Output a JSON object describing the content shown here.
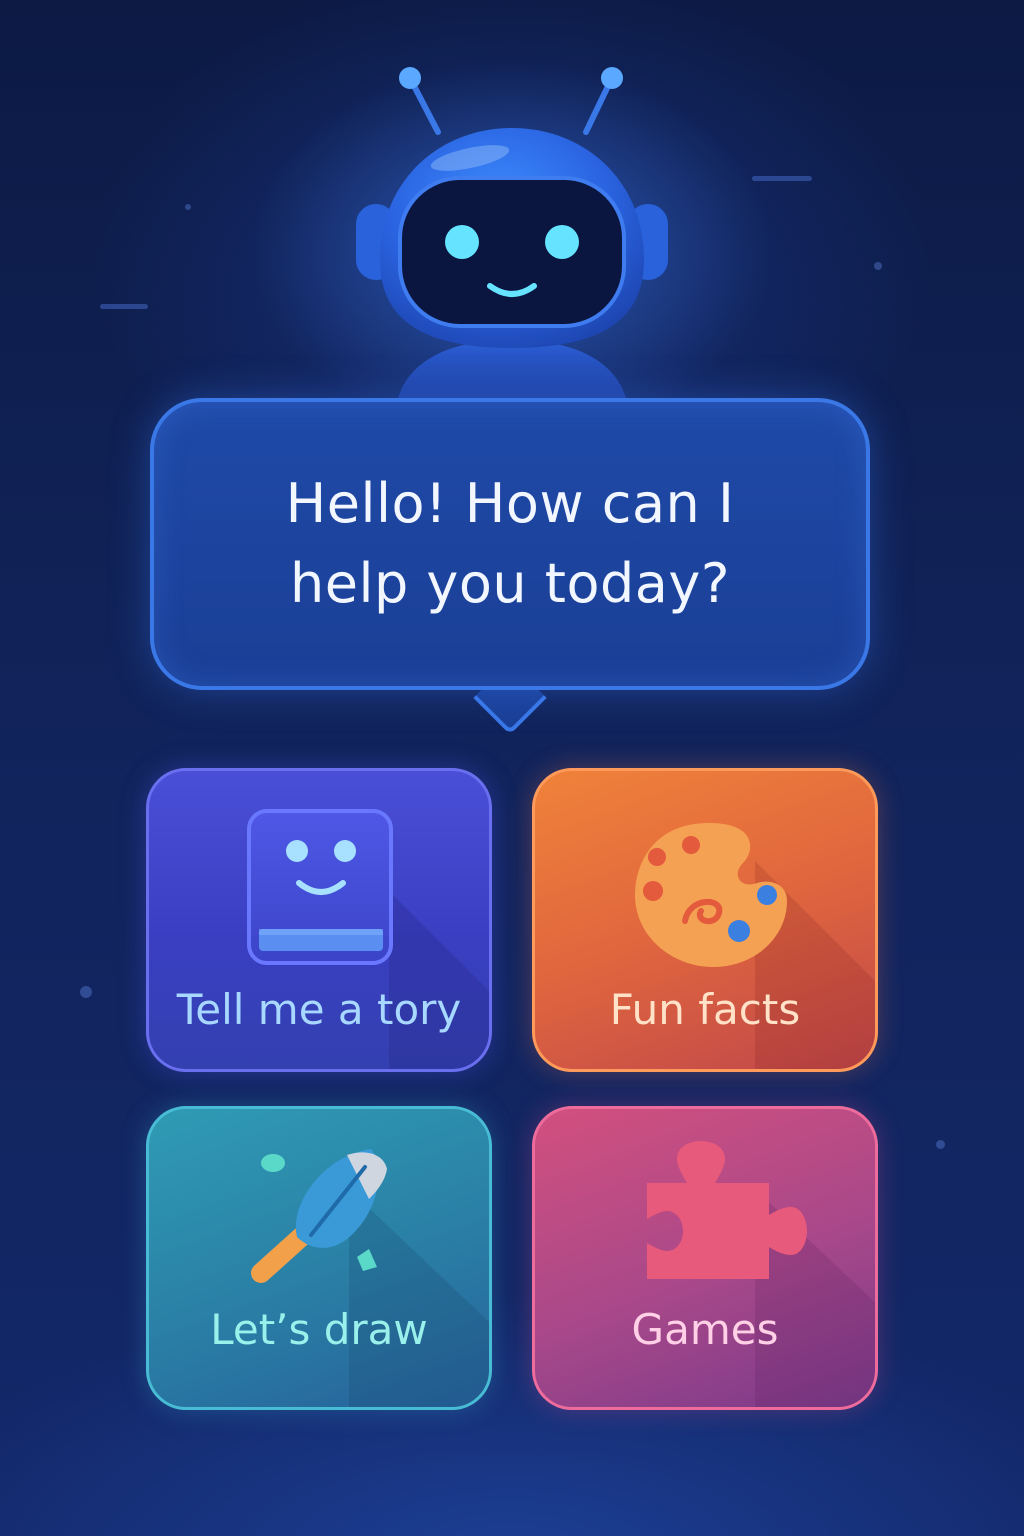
{
  "assistant": {
    "greeting_line1": "Hello! How can I",
    "greeting_line2": "help you today?"
  },
  "options": [
    {
      "label": "Tell me a tory",
      "icon": "book-face-icon",
      "color": "#4a4fd8",
      "label_color": "#a8d8ff"
    },
    {
      "label": "Fun facts",
      "icon": "paint-palette-icon",
      "color": "#e8713c",
      "label_color": "#ffe2c8"
    },
    {
      "label": "Let’s draw",
      "icon": "paintbrush-icon",
      "color": "#2a88ad",
      "label_color": "#9af0ea"
    },
    {
      "label": "Games",
      "icon": "puzzle-piece-icon",
      "color": "#b04a8a",
      "label_color": "#ffd0e6"
    }
  ],
  "colors": {
    "background": "#0f1f50",
    "bubble": "#1f4aa8",
    "bubble_border": "#3a78e8",
    "robot_glow": "#5fe0ff"
  }
}
